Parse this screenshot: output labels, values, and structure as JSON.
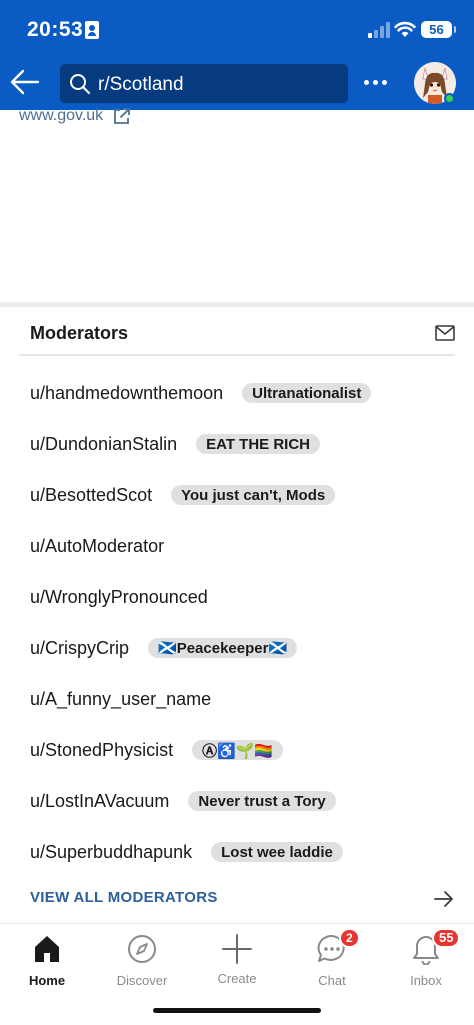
{
  "status_bar": {
    "time": "20:53",
    "battery": "56"
  },
  "header": {
    "search_text": "r/Scotland"
  },
  "link": {
    "text": "www.gov.uk"
  },
  "moderators": {
    "title": "Moderators",
    "items": [
      {
        "username": "u/handmedownthemoon",
        "flair": "Ultranationalist"
      },
      {
        "username": "u/DundonianStalin",
        "flair": "EAT THE RICH"
      },
      {
        "username": "u/BesottedScot",
        "flair": "You just can't, Mods"
      },
      {
        "username": "u/AutoModerator",
        "flair": ""
      },
      {
        "username": "u/WronglyPronounced",
        "flair": ""
      },
      {
        "username": "u/CrispyCrip",
        "flair": "🏴󠁧󠁢󠁳󠁣󠁴󠁿Peacekeeper🏴󠁧󠁢󠁳󠁣󠁴󠁿"
      },
      {
        "username": "u/A_funny_user_name",
        "flair": ""
      },
      {
        "username": "u/StonedPhysicist",
        "flair": "Ⓐ♿🌱🏳️‍🌈"
      },
      {
        "username": "u/LostInAVacuum",
        "flair": "Never trust a Tory"
      },
      {
        "username": "u/Superbuddhapunk",
        "flair": "Lost wee laddie"
      }
    ],
    "view_all_label": "VIEW ALL MODERATORS"
  },
  "bottom_nav": {
    "items": [
      {
        "label": "Home",
        "icon": "home-icon",
        "active": true
      },
      {
        "label": "Discover",
        "icon": "compass-icon"
      },
      {
        "label": "Create",
        "icon": "plus-icon"
      },
      {
        "label": "Chat",
        "icon": "chat-icon",
        "badge": "2"
      },
      {
        "label": "Inbox",
        "icon": "bell-icon",
        "badge": "55"
      }
    ]
  },
  "colors": {
    "header_bg": "#0a5cc4",
    "search_bg": "#063b80",
    "badge": "#e8352f",
    "link": "#2d5f9a"
  }
}
